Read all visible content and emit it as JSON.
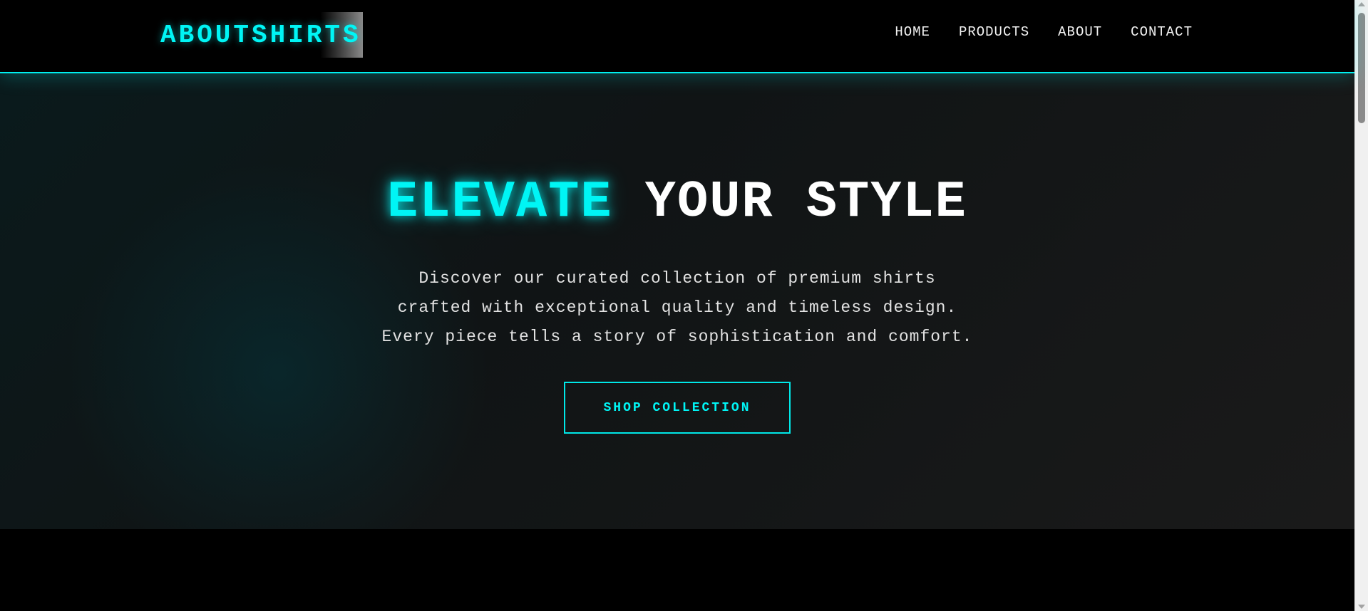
{
  "header": {
    "logo": "ABOUTSHIRTS",
    "nav": [
      {
        "label": "HOME"
      },
      {
        "label": "PRODUCTS"
      },
      {
        "label": "ABOUT"
      },
      {
        "label": "CONTACT"
      }
    ]
  },
  "hero": {
    "title_accent": "ELEVATE",
    "title_rest": "YOUR STYLE",
    "description_lines": [
      "Discover our curated collection of premium shirts",
      "crafted with exceptional quality and timeless design.",
      "Every piece tells a story of sophistication and comfort."
    ],
    "cta_label": "SHOP COLLECTION"
  },
  "colors": {
    "accent": "#00f5f5",
    "background": "#000000",
    "hero_bg": "#141818",
    "text": "#ffffff"
  },
  "scrollbar": {
    "up_icon": "arrow-up-icon",
    "down_icon": "arrow-down-icon"
  }
}
